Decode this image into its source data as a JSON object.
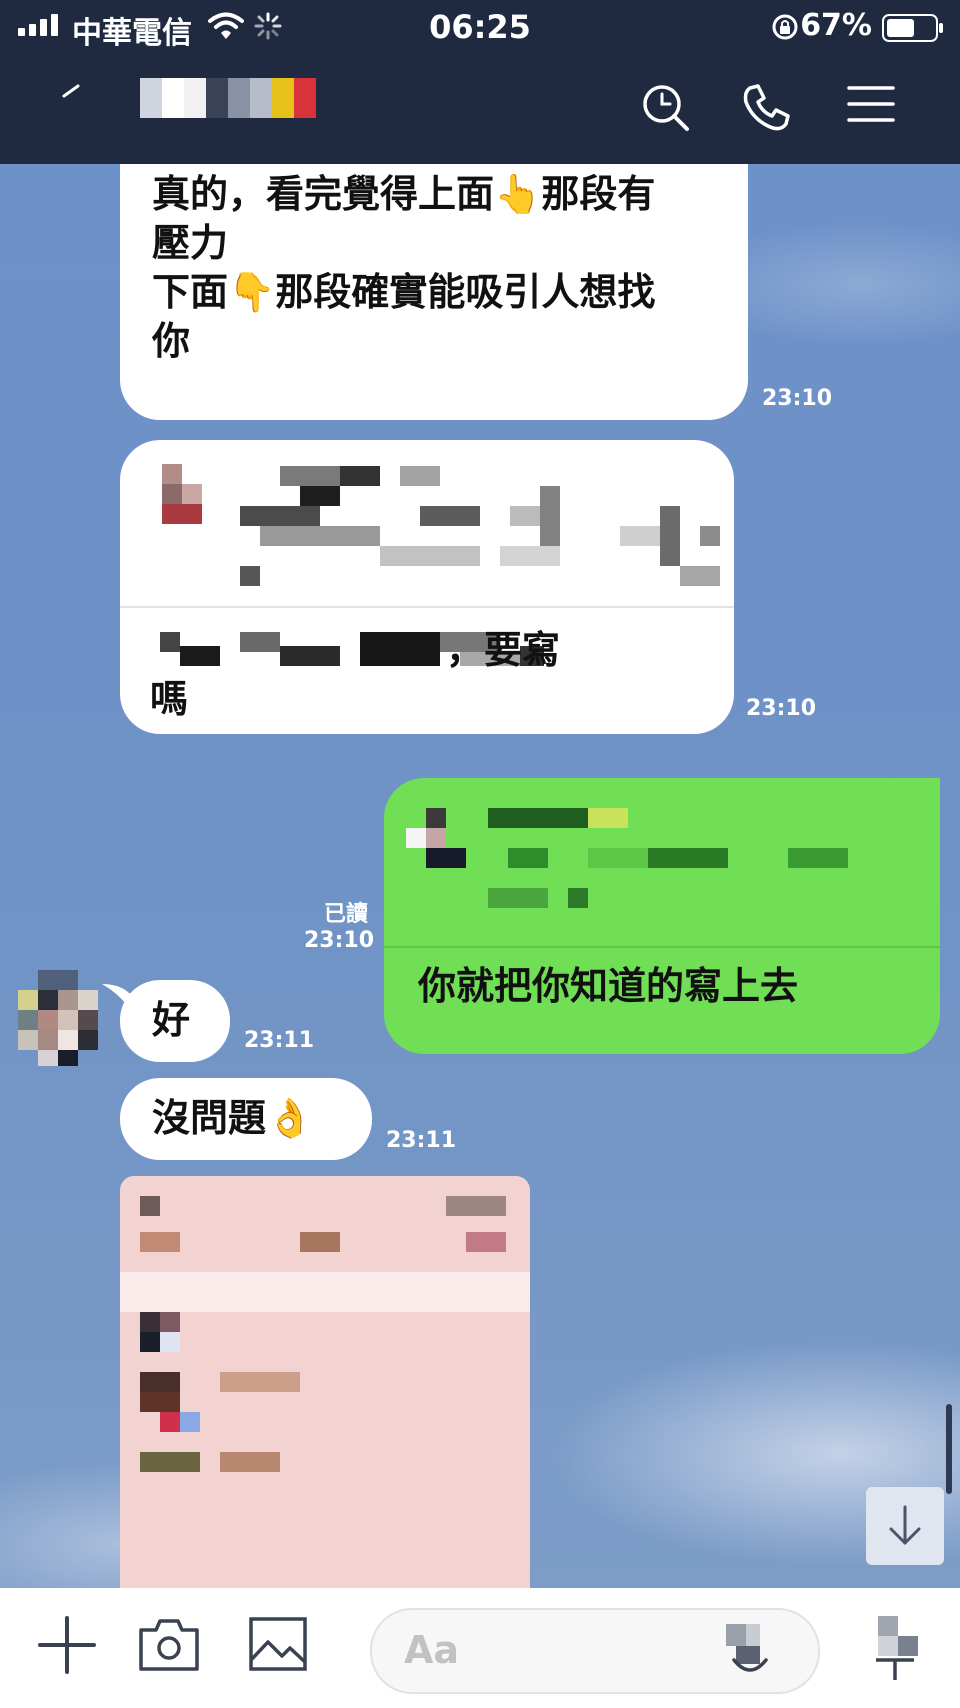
{
  "status_bar": {
    "carrier": "中華電信",
    "time": "06:25",
    "battery": "67%",
    "battery_level": 0.67
  },
  "header": {
    "icons": [
      "back-icon",
      "search-icon",
      "phone-icon",
      "menu-icon"
    ]
  },
  "messages": [
    {
      "side": "left",
      "text": "真的，看完覺得上面👆那段有\n壓力\n下面👇那段確實能吸引人想找\n你",
      "time": "23:10"
    },
    {
      "side": "left",
      "text": "，要寫\n嗎",
      "time": "23:10"
    },
    {
      "side": "right",
      "text": "你就把你知道的寫上去",
      "read": "已讀",
      "time": "23:10"
    },
    {
      "side": "left",
      "text": "好",
      "time": "23:11"
    },
    {
      "side": "left",
      "text": "沒問題👌",
      "time": "23:11"
    }
  ],
  "input": {
    "placeholder": "Aa"
  },
  "colors": {
    "header": "#1f2a40",
    "outgoing_bubble": "#71df56",
    "incoming_bubble": "#ffffff",
    "chat_background": "#6f93c6"
  }
}
